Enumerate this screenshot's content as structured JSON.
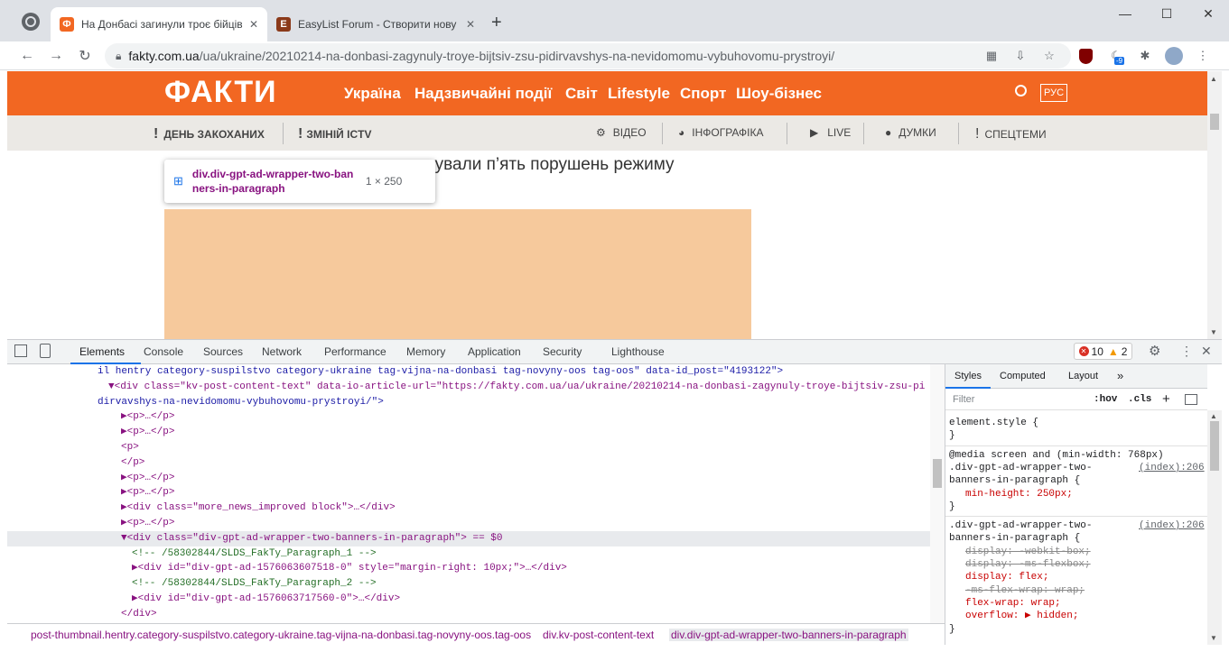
{
  "tabs": [
    {
      "title": "На Донбасі загинули троє бійців",
      "favicon": "Ф",
      "active": true
    },
    {
      "title": "EasyList Forum - Створити нову",
      "favicon": "E",
      "active": false
    }
  ],
  "window": {
    "minimize": "—",
    "maximize": "☐",
    "close": "✕"
  },
  "address": {
    "domain": "fakty.com.ua",
    "path": "/ua/ukraine/20210214-na-donbasi-zagynuly-troye-bijtsiv-zsu-pidirvavshys-na-nevidomomu-vybuhovomu-prystroyi/"
  },
  "extension_badge": "-9",
  "site": {
    "logo": "ФАКТИ",
    "nav": [
      "Україна",
      "Надзвичайні події",
      "Світ",
      "Lifestyle",
      "Спорт",
      "Шоу-бізнес"
    ],
    "lang": "РУС",
    "subnav_left": [
      "ДЕНЬ ЗАКОХАНИХ",
      "ЗМІНІЙ ICTV"
    ],
    "subnav_right": [
      "ВІДЕО",
      "ІНФОГРАФІКА",
      "LIVE",
      "ДУМКИ",
      "СПЕЦТЕМИ"
    ],
    "article_snippet": "вували п’ять порушень режиму",
    "tooltip_selector": "div.div-gpt-ad-wrapper-two-banners-in-paragraph",
    "tooltip_size": "1 × 250"
  },
  "devtools": {
    "tabs": [
      "Elements",
      "Console",
      "Sources",
      "Network",
      "Performance",
      "Memory",
      "Application",
      "Security",
      "Lighthouse"
    ],
    "errors": "10",
    "warnings": "2",
    "dom_lines": [
      {
        "indent": 0,
        "text": "il hentry category-suspilstvo category-ukraine tag-vijna-na-donbasi tag-novyny-oos tag-oos\" data-id_post=\"4193122\">",
        "kind": "plain"
      },
      {
        "indent": 1,
        "text": "▼<div class=\"kv-post-content-text\" data-io-article-url=\"https://fakty.com.ua/ua/ukraine/20210214-na-donbasi-zagynuly-troye-bijtsiv-zsu-pi",
        "kind": "tag"
      },
      {
        "indent": 0,
        "text": "dirvavshys-na-nevidomomu-vybuhovomu-prystroyi/\">",
        "kind": "plain"
      },
      {
        "indent": 2,
        "text": "▶<p>…</p>",
        "kind": "tag"
      },
      {
        "indent": 2,
        "text": "▶<p>…</p>",
        "kind": "tag"
      },
      {
        "indent": 2,
        "text": "<p>",
        "kind": "tag"
      },
      {
        "indent": 2,
        "text": "</p>",
        "kind": "tag"
      },
      {
        "indent": 2,
        "text": "▶<p>…</p>",
        "kind": "tag"
      },
      {
        "indent": 2,
        "text": "▶<p>…</p>",
        "kind": "tag"
      },
      {
        "indent": 2,
        "text": "▶<div class=\"more_news_improved block\">…</div>",
        "kind": "tag"
      },
      {
        "indent": 2,
        "text": "▶<p>…</p>",
        "kind": "tag"
      },
      {
        "indent": 2,
        "text": "▼<div class=\"div-gpt-ad-wrapper-two-banners-in-paragraph\"> == $0",
        "kind": "selected"
      },
      {
        "indent": 3,
        "text": "<!-- /58302844/SLDS_FakTy_Paragraph_1 -->",
        "kind": "comment"
      },
      {
        "indent": 3,
        "text": "▶<div id=\"div-gpt-ad-1576063607518-0\" style=\"margin-right: 10px;\">…</div>",
        "kind": "tag"
      },
      {
        "indent": 3,
        "text": "<!-- /58302844/SLDS_FakTy_Paragraph_2 -->",
        "kind": "comment"
      },
      {
        "indent": 3,
        "text": "▶<div id=\"div-gpt-ad-1576063717560-0\">…</div>",
        "kind": "tag"
      },
      {
        "indent": 2,
        "text": "</div>",
        "kind": "tag"
      }
    ],
    "breadcrumb": [
      "post-thumbnail.hentry.category-suspilstvo.category-ukraine.tag-vijna-na-donbasi.tag-novyny-oos.tag-oos",
      "div.kv-post-content-text",
      "div.div-gpt-ad-wrapper-two-banners-in-paragraph"
    ],
    "styles_tabs": [
      "Styles",
      "Computed",
      "Layout",
      "»"
    ],
    "filter_placeholder": "Filter",
    "hov": ":hov",
    "cls": ".cls",
    "style_lines": [
      {
        "text": "element.style {",
        "kind": "sel"
      },
      {
        "text": "}",
        "kind": "sel"
      },
      {
        "text": "@media screen and (min-width: 768px)",
        "kind": "sel"
      },
      {
        "text": ".div-gpt-ad-wrapper-two-",
        "kind": "sel",
        "link": "(index):206"
      },
      {
        "text": "banners-in-paragraph {",
        "kind": "sel"
      },
      {
        "text": "min-height: 250px;",
        "kind": "prop"
      },
      {
        "text": "}",
        "kind": "sel"
      },
      {
        "text": ".div-gpt-ad-wrapper-two-",
        "kind": "sel",
        "link": "(index):206"
      },
      {
        "text": "banners-in-paragraph {",
        "kind": "sel"
      },
      {
        "text": "display: -webkit-box;",
        "kind": "strike"
      },
      {
        "text": "display: -ms-flexbox;",
        "kind": "strike"
      },
      {
        "text": "display: flex;",
        "kind": "prop"
      },
      {
        "text": "-ms-flex-wrap: wrap;",
        "kind": "strike"
      },
      {
        "text": "flex-wrap: wrap;",
        "kind": "prop"
      },
      {
        "text": "overflow: ▶ hidden;",
        "kind": "prop"
      },
      {
        "text": "}",
        "kind": "sel"
      }
    ]
  }
}
